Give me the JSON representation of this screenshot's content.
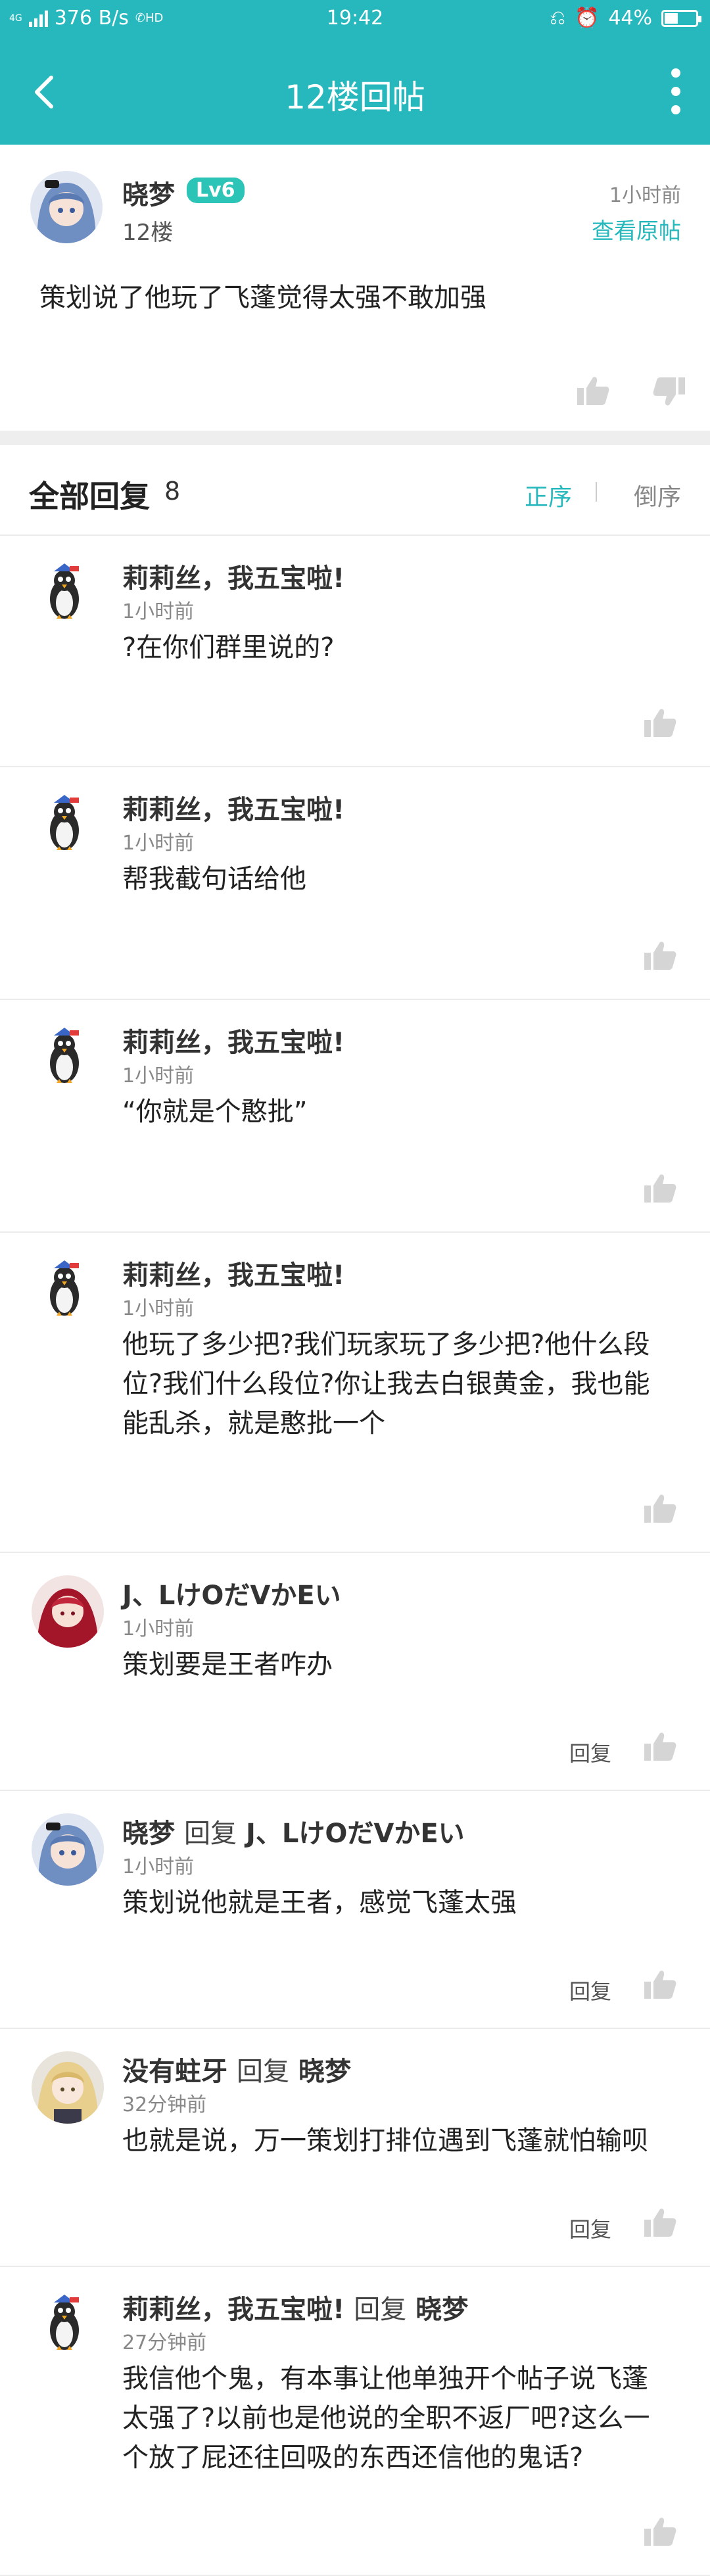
{
  "status_bar": {
    "network": "4G",
    "speed": "376 B/s",
    "hd": "HD",
    "time": "19:42",
    "battery": "44%",
    "battery_level": 0.44
  },
  "header": {
    "title": "12楼回帖"
  },
  "original_post": {
    "author": "晓梦",
    "level": "Lv6",
    "floor": "12楼",
    "time": "1小时前",
    "view_original": "查看原帖",
    "text": "策划说了他玩了飞蓬觉得太强不敢加强"
  },
  "replies_header": {
    "label": "全部回复",
    "count": "8",
    "sort_asc": "正序",
    "sort_desc": "倒序"
  },
  "replies": [
    {
      "author": "莉莉丝，我五宝啦!",
      "time": "1小时前",
      "text": "?在你们群里说的?"
    },
    {
      "author": "莉莉丝，我五宝啦!",
      "time": "1小时前",
      "text": "帮我截句话给他"
    },
    {
      "author": "莉莉丝，我五宝啦!",
      "time": "1小时前",
      "text": "“你就是个憨批”"
    },
    {
      "author": "莉莉丝，我五宝啦!",
      "time": "1小时前",
      "text": "他玩了多少把?我们玩家玩了多少把?他什么段位?我们什么段位?你让我去白银黄金，我也能能乱杀，就是憨批一个"
    },
    {
      "author": "J、LけOだVかEい",
      "time": "1小时前",
      "text": "策划要是王者咋办",
      "reply_label": "回复"
    },
    {
      "author": "晓梦",
      "reply_word": "回复",
      "reply_to": "J、LけOだVかEい",
      "time": "1小时前",
      "text": "策划说他就是王者，感觉飞蓬太强",
      "reply_label": "回复"
    },
    {
      "author": "没有蛀牙",
      "reply_word": "回复",
      "reply_to": "晓梦",
      "time": "32分钟前",
      "text": "也就是说，万一策划打排位遇到飞蓬就怕输呗",
      "reply_label": "回复"
    },
    {
      "author": "莉莉丝，我五宝啦!",
      "reply_word": "回复",
      "reply_to": "晓梦",
      "time": "27分钟前",
      "text": "我信他个鬼，有本事让他单独开个帖子说飞蓬太强了?以前也是他说的全职不返厂吧?这么一个放了屁还往回吸的东西还信他的鬼话?"
    }
  ],
  "icons": {
    "back": "back-arrow-icon",
    "more": "more-vertical-icon",
    "like": "thumbs-up-icon",
    "dislike": "thumbs-down-icon"
  },
  "colors": {
    "primary": "#27b8bd",
    "level_badge": "#2bc4b6",
    "thumb": "#d5d5d5"
  }
}
